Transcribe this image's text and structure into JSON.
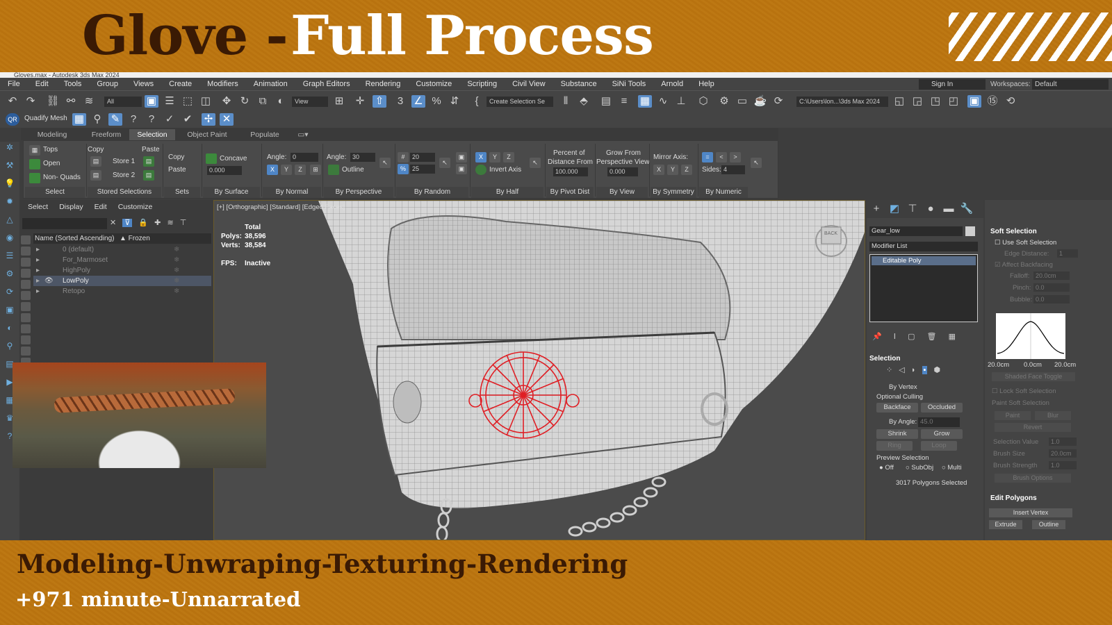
{
  "banner": {
    "title_dark": "Glove -",
    "title_light": "Full Process",
    "subtitle_1": "Modeling-Unwraping-Texturing-Rendering",
    "subtitle_2": "+971 minute-Unnarrated",
    "colors": {
      "accent": "#b8730f",
      "dark_text": "#3a1a04",
      "light_text": "#ffffff"
    }
  },
  "app": {
    "window_title": "Gloves.max - Autodesk 3ds Max 2024",
    "menu": [
      "File",
      "Edit",
      "Tools",
      "Group",
      "Views",
      "Create",
      "Modifiers",
      "Animation",
      "Graph Editors",
      "Rendering",
      "Customize",
      "Scripting",
      "Civil View",
      "Substance",
      "SiNi Tools",
      "Arnold",
      "Help"
    ],
    "sign_in": "Sign In",
    "workspaces_label": "Workspaces:",
    "workspaces_value": "Default",
    "toolbar": {
      "filter": "All",
      "ref_coord": "View",
      "selection_set": "Create Selection Se",
      "project_path": "C:\\Users\\lon...\\3ds Max 2024"
    },
    "toolbar2": {
      "quadify": "Quadify Mesh",
      "qr_badge": "QR"
    }
  },
  "ribbon": {
    "tabs": [
      "Modeling",
      "Freeform",
      "Selection",
      "Object Paint",
      "Populate"
    ],
    "active_tab": "Selection",
    "select": {
      "tops": "Tops",
      "open": "Open",
      "nonquads": "Non- Quads",
      "footer": "Select"
    },
    "stored": {
      "copy": "Copy",
      "paste": "Paste",
      "store1": "Store 1",
      "store2": "Store 2",
      "footer": "Stored Selections"
    },
    "sets": {
      "copy": "Copy",
      "paste": "Paste",
      "footer": "Sets"
    },
    "by_surface": {
      "concave": "Concave",
      "value": "0.000",
      "footer": "By Surface"
    },
    "by_normal": {
      "angle_label": "Angle:",
      "angle": "0",
      "footer": "By Normal"
    },
    "by_perspective": {
      "angle_label": "Angle:",
      "angle": "30",
      "outline": "Outline",
      "footer": "By Perspective"
    },
    "by_random": {
      "count": "20",
      "percent": "25",
      "footer": "By Random"
    },
    "by_half": {
      "invert": "Invert Axis",
      "footer": "By Half"
    },
    "by_pivot": {
      "label1": "Percent of",
      "label2": "Distance From",
      "value": "100.000",
      "footer": "By Pivot Dist"
    },
    "by_view": {
      "label1": "Grow From",
      "label2": "Perspective View",
      "value": "0.000",
      "footer": "By View"
    },
    "by_symmetry": {
      "label": "Mirror Axis:",
      "footer": "By Symmetry"
    },
    "by_numeric": {
      "sides_label": "Sides:",
      "sides": "4",
      "footer": "By Numeric"
    },
    "axes": [
      "X",
      "Y",
      "Z"
    ]
  },
  "explorer": {
    "menu": [
      "Select",
      "Display",
      "Edit",
      "Customize"
    ],
    "columns": [
      "Name (Sorted Ascending)",
      "▲ Frozen"
    ],
    "rows": [
      {
        "name": "0 (default)",
        "selected": false
      },
      {
        "name": "For_Marmoset",
        "selected": false
      },
      {
        "name": "HighPoly",
        "selected": false
      },
      {
        "name": "LowPoly",
        "selected": true
      },
      {
        "name": "Retopo",
        "selected": false
      }
    ]
  },
  "viewport": {
    "label": "[+] [Orthographic] [Standard] [Edged Faces]",
    "stats_header": "Total",
    "polys_label": "Polys:",
    "polys": "38,596",
    "verts_label": "Verts:",
    "verts": "38,584",
    "fps_label": "FPS:",
    "fps": "Inactive",
    "viewcube_face": "BACK"
  },
  "command_panel": {
    "object_name": "Gear_low",
    "modifier_list": "Modifier List",
    "stack_item": "Editable Poly",
    "selection_title": "Selection",
    "by_vertex": "By Vertex",
    "optional_culling": "Optional Culling",
    "backface": "Backface",
    "occluded": "Occluded",
    "by_angle": "By Angle:",
    "by_angle_value": "45.0",
    "shrink": "Shrink",
    "grow": "Grow",
    "ring": "Ring",
    "loop": "Loop",
    "preview_selection": "Preview Selection",
    "preview_options": [
      "Off",
      "SubObj",
      "Multi"
    ],
    "status": "3017 Polygons Selected"
  },
  "soft_selection": {
    "title": "Soft Selection",
    "use": "Use Soft Selection",
    "edge_distance": "Edge Distance:",
    "edge_distance_value": "1",
    "affect_backfacing": "Affect Backfacing",
    "falloff": "Falloff:",
    "falloff_value": "20.0cm",
    "pinch": "Pinch:",
    "pinch_value": "0.0",
    "bubble": "Bubble:",
    "bubble_value": "0.0",
    "curve_labels": [
      "20.0cm",
      "0.0cm",
      "20.0cm"
    ],
    "shaded_face_toggle": "Shaded Face Toggle",
    "lock": "Lock Soft Selection",
    "paint_soft": "Paint Soft Selection",
    "paint": "Paint",
    "blur": "Blur",
    "revert": "Revert",
    "selection_value": "Selection Value",
    "selection_value_v": "1.0",
    "brush_size": "Brush Size",
    "brush_size_v": "20.0cm",
    "brush_strength": "Brush Strength",
    "brush_strength_v": "1.0",
    "brush_options": "Brush Options",
    "edit_polygons": "Edit Polygons",
    "insert_vertex": "Insert Vertex",
    "extrude": "Extrude",
    "outline": "Outline"
  }
}
